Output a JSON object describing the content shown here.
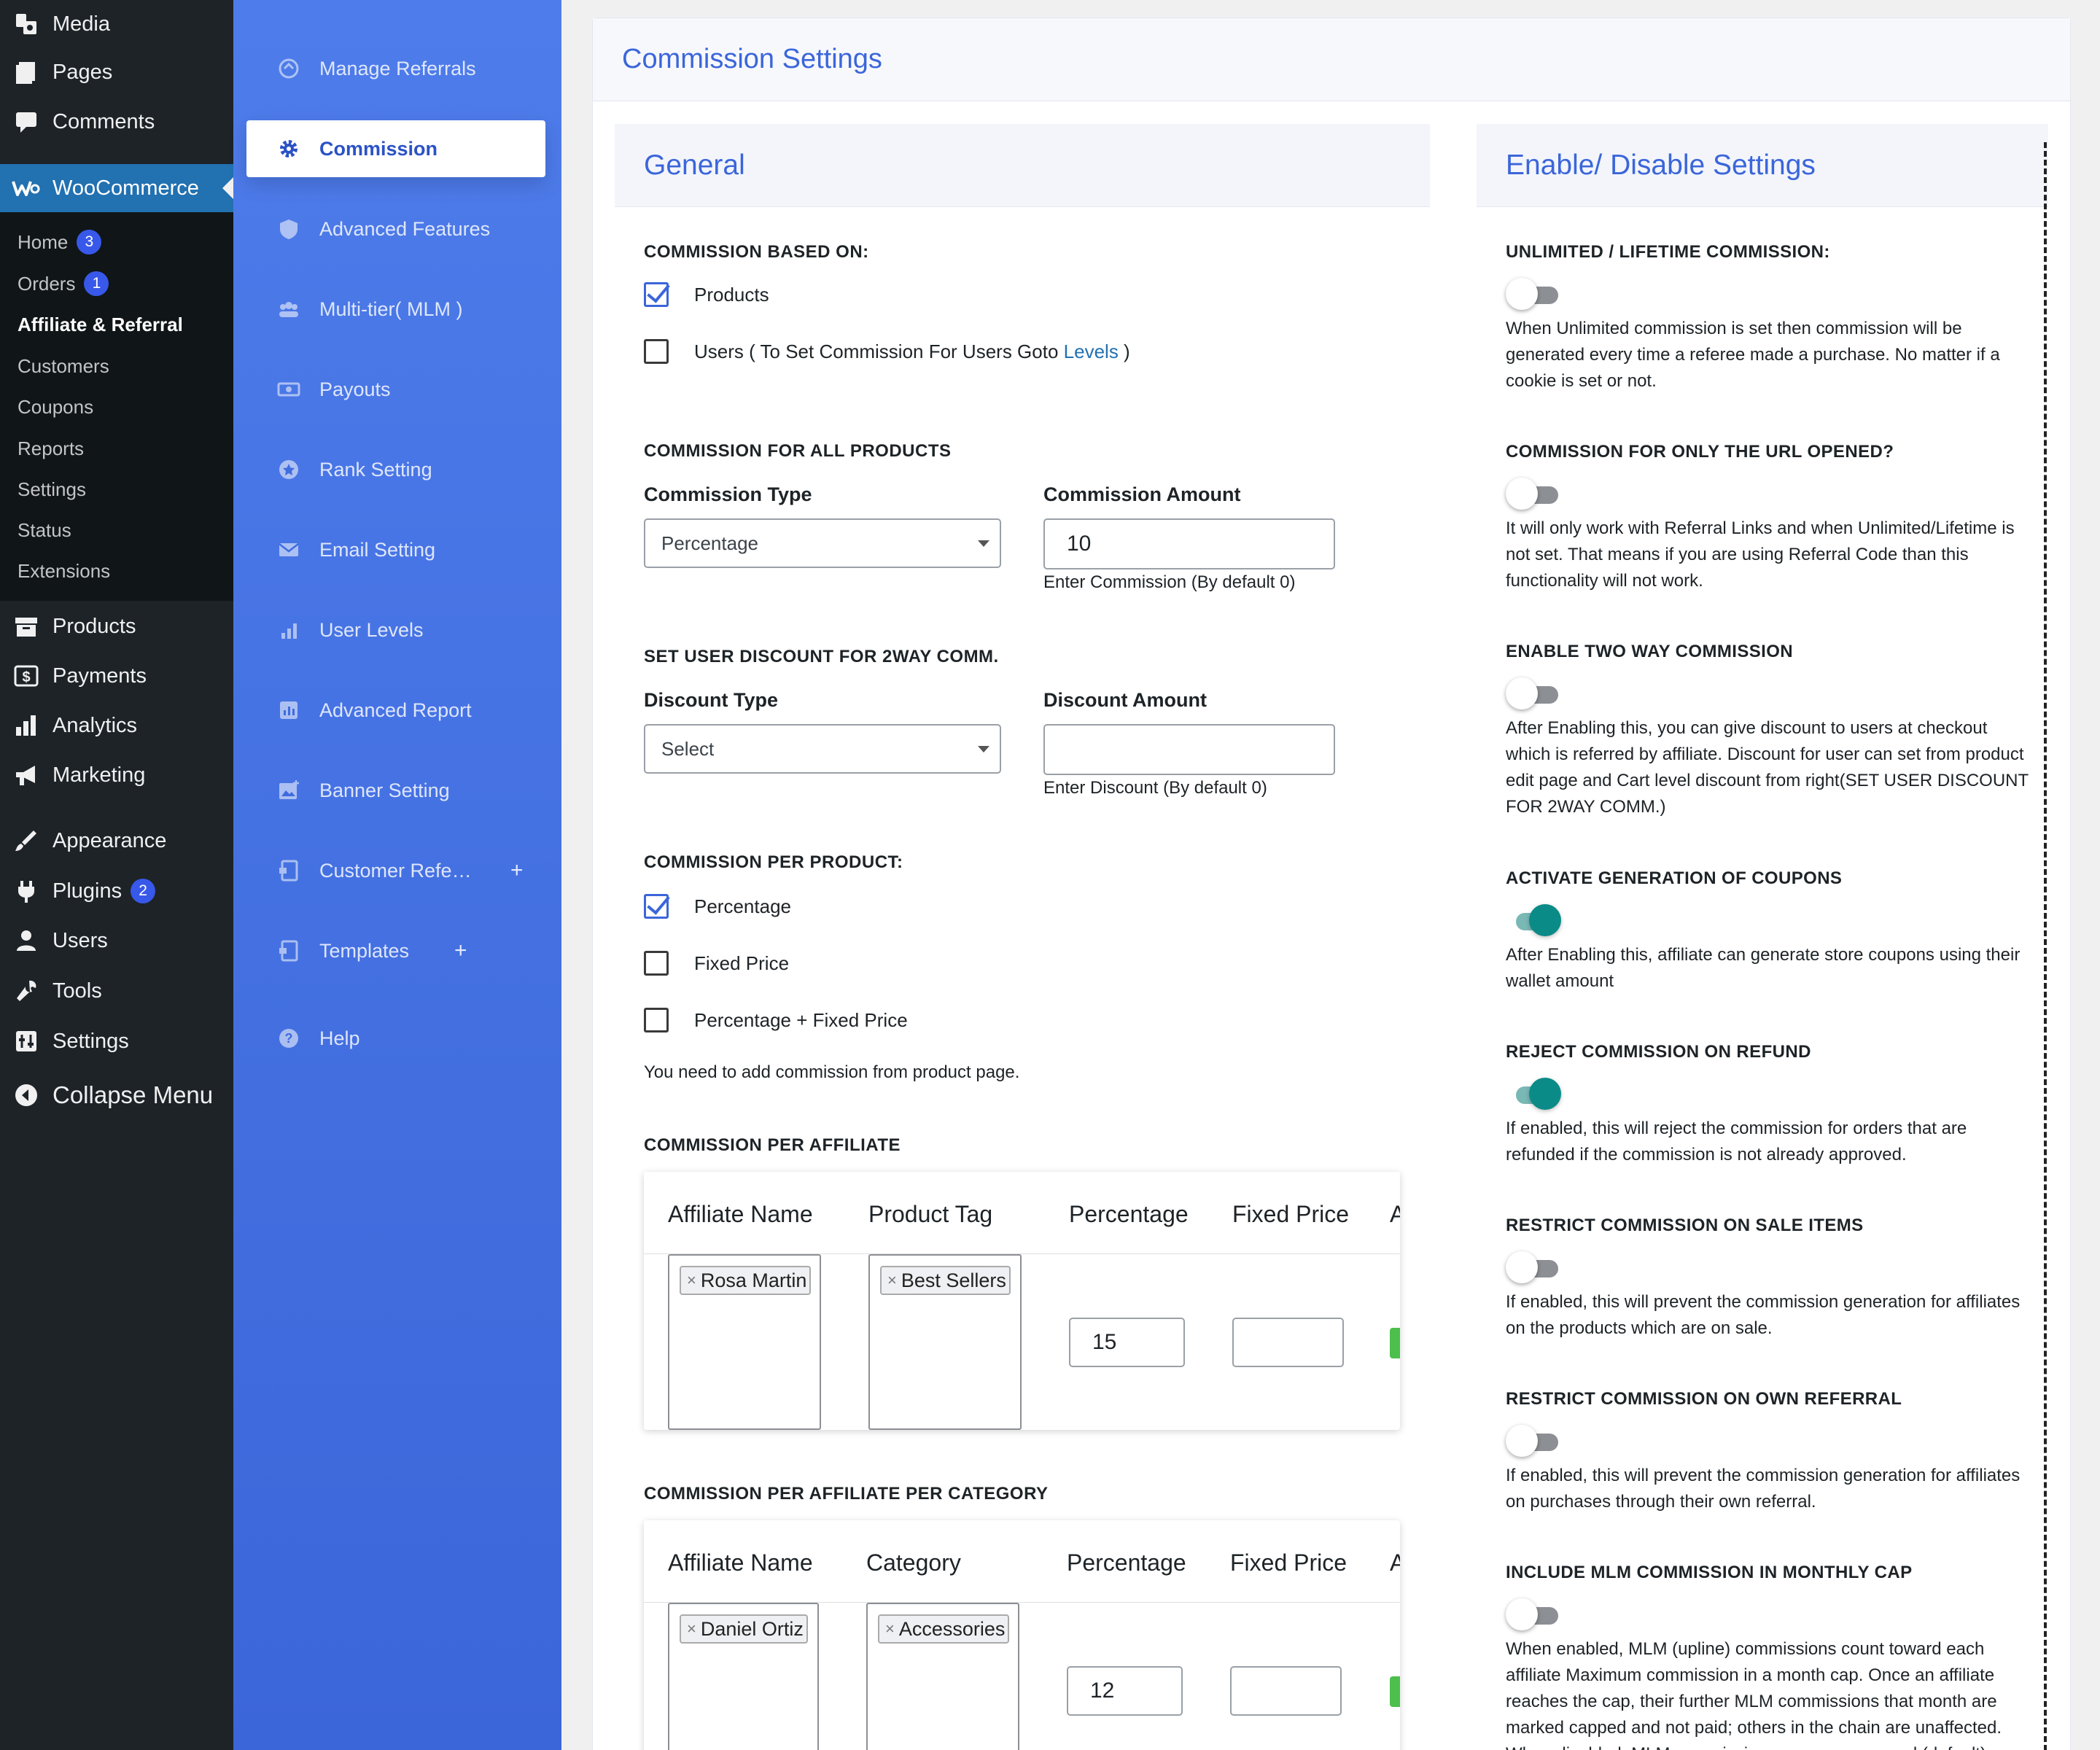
{
  "wp_menu": {
    "top": [
      {
        "label": "Media",
        "icon": "media-icon"
      },
      {
        "label": "Pages",
        "icon": "pages-icon"
      },
      {
        "label": "Comments",
        "icon": "comments-icon"
      }
    ],
    "woocommerce": {
      "label": "WooCommerce",
      "icon": "woo-icon"
    },
    "woo_sub": [
      {
        "label": "Home",
        "badge": "3"
      },
      {
        "label": "Orders",
        "badge": "1"
      },
      {
        "label": "Affiliate & Referral"
      },
      {
        "label": "Customers"
      },
      {
        "label": "Coupons"
      },
      {
        "label": "Reports"
      },
      {
        "label": "Settings"
      },
      {
        "label": "Status"
      },
      {
        "label": "Extensions"
      }
    ],
    "bottom": [
      {
        "label": "Products",
        "icon": "products-icon"
      },
      {
        "label": "Payments",
        "icon": "payments-icon"
      },
      {
        "label": "Analytics",
        "icon": "analytics-icon"
      },
      {
        "label": "Marketing",
        "icon": "marketing-icon"
      },
      {
        "label": "Appearance",
        "icon": "appearance-icon"
      },
      {
        "label": "Plugins",
        "icon": "plugins-icon",
        "badge": "2"
      },
      {
        "label": "Users",
        "icon": "users-icon"
      },
      {
        "label": "Tools",
        "icon": "tools-icon"
      },
      {
        "label": "Settings",
        "icon": "settings-icon"
      },
      {
        "label": "Collapse Menu",
        "icon": "collapse-icon"
      }
    ]
  },
  "plugin_nav": [
    {
      "label": "Manage Referrals",
      "icon": "referrals-icon"
    },
    {
      "label": "Commission",
      "icon": "gear-icon",
      "active": true
    },
    {
      "label": "Advanced Features",
      "icon": "shield-icon"
    },
    {
      "label": "Multi-tier( MLM )",
      "icon": "group-icon"
    },
    {
      "label": "Payouts",
      "icon": "money-icon"
    },
    {
      "label": "Rank Setting",
      "icon": "star-icon"
    },
    {
      "label": "Email Setting",
      "icon": "envelope-icon"
    },
    {
      "label": "User Levels",
      "icon": "bars-icon"
    },
    {
      "label": "Advanced Report",
      "icon": "report-icon"
    },
    {
      "label": "Banner Setting",
      "icon": "image-icon"
    },
    {
      "label": "Customer Refe…",
      "icon": "doc-icon",
      "plus": "+"
    },
    {
      "label": "Templates",
      "icon": "doc-icon",
      "plus": "+"
    },
    {
      "label": "Help",
      "icon": "help-icon"
    }
  ],
  "page_title": "Commission Settings",
  "general": {
    "title": "General",
    "based_on": {
      "heading": "COMMISSION BASED ON:",
      "opt_products": "Products",
      "opt_users_prefix": "Users ( To Set Commission For Users Goto ",
      "opt_users_link": "Levels",
      "opt_users_suffix": " )",
      "products_checked": true,
      "users_checked": false
    },
    "all_products": {
      "heading": "COMMISSION FOR ALL PRODUCTS",
      "type_label": "Commission Type",
      "type_value": "Percentage",
      "amount_label": "Commission Amount",
      "amount_value": "10",
      "amount_help": "Enter Commission (By default 0)"
    },
    "discount": {
      "heading": "SET USER DISCOUNT FOR 2WAY COMM.",
      "type_label": "Discount Type",
      "type_value": "Select",
      "amount_label": "Discount Amount",
      "amount_value": "",
      "amount_help": "Enter Discount (By default 0)"
    },
    "per_product": {
      "heading": "COMMISSION PER PRODUCT:",
      "options": [
        "Percentage",
        "Fixed Price",
        "Percentage + Fixed Price"
      ],
      "checked": [
        true,
        false,
        false
      ],
      "note": "You need to add commission from product page."
    },
    "per_affiliate": {
      "heading": "COMMISSION PER AFFILIATE",
      "columns": [
        "Affiliate Name",
        "Product Tag",
        "Percentage",
        "Fixed Price",
        "A"
      ],
      "row": {
        "affiliate": "Rosa Martin",
        "tag": "Best Sellers",
        "percentage": "15",
        "fixed": ""
      }
    },
    "per_affiliate_category": {
      "heading": "COMMISSION PER AFFILIATE PER CATEGORY",
      "columns": [
        "Affiliate Name",
        "Category",
        "Percentage",
        "Fixed Price",
        "A"
      ],
      "row": {
        "affiliate": "Daniel Ortiz",
        "category": "Accessories",
        "percentage": "12",
        "fixed": ""
      }
    }
  },
  "toggles_panel": {
    "title": "Enable/ Disable Settings",
    "items": [
      {
        "title": "UNLIMITED / LIFETIME COMMISSION:",
        "on": false,
        "desc": "When Unlimited commission is set then commission will be generated every time a referee made a purchase. No matter if a cookie is set or not."
      },
      {
        "title": "COMMISSION FOR ONLY THE URL OPENED?",
        "on": false,
        "desc": "It will only work with Referral Links and when Unlimited/Lifetime is not set. That means if you are using Referral Code than this functionality will not work."
      },
      {
        "title": "ENABLE TWO WAY COMMISSION",
        "on": false,
        "desc": "After Enabling this, you can give discount to users at checkout which is referred by affiliate. Discount for user can set from product edit page and Cart level discount from right(SET USER DISCOUNT FOR 2WAY COMM.)"
      },
      {
        "title": "ACTIVATE GENERATION OF COUPONS",
        "on": true,
        "desc": "After Enabling this, affiliate can generate store coupons using their wallet amount"
      },
      {
        "title": "REJECT COMMISSION ON REFUND",
        "on": true,
        "desc": "If enabled, this will reject the commission for orders that are refunded if the commission is not already approved."
      },
      {
        "title": "RESTRICT COMMISSION ON SALE ITEMS",
        "on": false,
        "desc": "If enabled, this will prevent the commission generation for affiliates on the products which are on sale."
      },
      {
        "title": "RESTRICT COMMISSION ON OWN REFERRAL",
        "on": false,
        "desc": "If enabled, this will prevent the commission generation for affiliates on purchases through their own referral."
      },
      {
        "title": "INCLUDE MLM COMMISSION IN MONTHLY CAP",
        "on": false,
        "desc": "When enabled, MLM (upline) commissions count toward each affiliate Maximum commission in a month cap. Once an affiliate reaches the cap, their further MLM commissions that month are marked capped and not paid; others in the chain are unaffected. When disabled, MLM commissions are never capped (default)."
      }
    ]
  }
}
